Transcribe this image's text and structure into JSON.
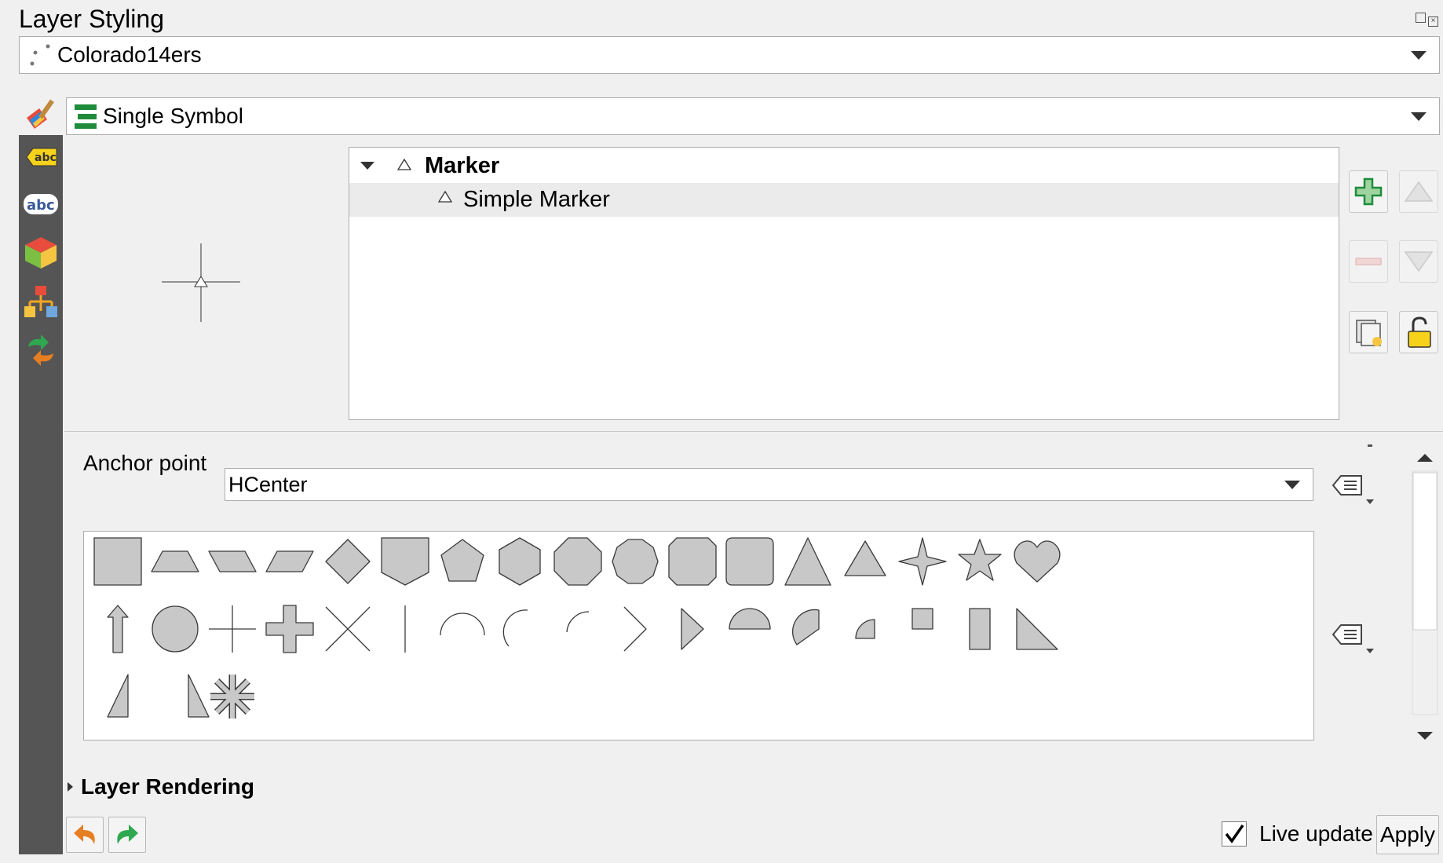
{
  "panel": {
    "title": "Layer Styling"
  },
  "layer_select": {
    "value": "Colorado14ers"
  },
  "renderer_select": {
    "value": "Single Symbol"
  },
  "left_rail": {
    "items": [
      {
        "icon": "labels-icon"
      },
      {
        "icon": "masks-icon"
      },
      {
        "icon": "3d-view-icon"
      },
      {
        "icon": "diagrams-icon"
      },
      {
        "icon": "history-icon"
      }
    ]
  },
  "symbol_tree": {
    "items": [
      {
        "label": "Marker",
        "level": 0,
        "expanded": true,
        "selected": false
      },
      {
        "label": "Simple Marker",
        "level": 1,
        "selected": true
      }
    ]
  },
  "anchor": {
    "label": "Anchor point",
    "value": "HCenter"
  },
  "section": {
    "layer_rendering": "Layer Rendering"
  },
  "footer": {
    "live_update_label": "Live update",
    "live_update_checked": true,
    "apply_label": "Apply"
  },
  "colors": {
    "shape_fill": "#c8c8c8",
    "shape_stroke": "#3a3a3a",
    "rail_bg": "#555555",
    "accent_green": "#1e8c3a"
  },
  "marker_shapes": [
    "square",
    "trapezoid",
    "parallelogram-right",
    "parallelogram-left",
    "diamond",
    "shield",
    "pentagon",
    "hexagon",
    "octagon",
    "decagon",
    "square-with-corners",
    "rounded-square",
    "triangle",
    "equilateral-triangle",
    "four-pointed-star",
    "star",
    "heart",
    "arrow",
    "circle",
    "cross",
    "cross-fill",
    "cross2",
    "line",
    "semi-arc",
    "third-arc",
    "quarter-arc",
    "arrowhead",
    "filled-arrowhead",
    "half-circle",
    "third-circle",
    "quarter-circle",
    "half-square",
    "diagonal-half-square",
    "right-half-triangle",
    "left-half-triangle",
    "half-triangle",
    "asterisk-fill"
  ]
}
